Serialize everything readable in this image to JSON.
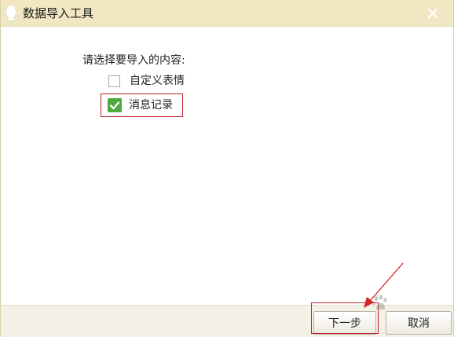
{
  "window": {
    "title": "数据导入工具",
    "titlebar_color": "#f1e7c3"
  },
  "content": {
    "prompt": "请选择要导入的内容:",
    "options": [
      {
        "label": "自定义表情",
        "checked": false
      },
      {
        "label": "消息记录",
        "checked": true
      }
    ]
  },
  "footer": {
    "next_label": "下一步",
    "cancel_label": "取消"
  },
  "annotation": {
    "highlight_color": "#c0232b",
    "check_color": "#4caa3c"
  },
  "icons": {
    "app": "qq-penguin-icon",
    "close": "close-icon",
    "check": "checkmark-icon",
    "watermark": "baidu-paw-icon"
  }
}
